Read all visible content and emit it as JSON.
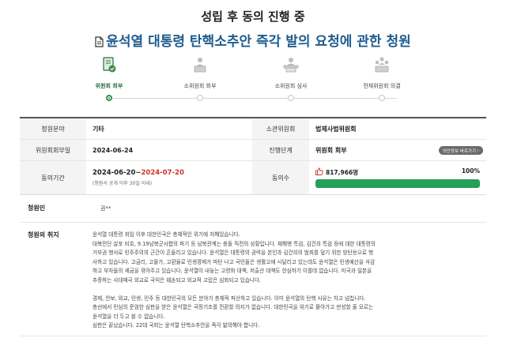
{
  "status_heading": "성립 후 동의 진행 중",
  "title": "윤석열 대통령 탄핵소추안 즉각 발의 요청에 관한 청원",
  "steps": [
    {
      "label": "위원회 회부",
      "active": true,
      "icon": "document-check-icon"
    },
    {
      "label": "소위원회 회부",
      "active": false,
      "icon": "podium-icon"
    },
    {
      "label": "소위원회 심사",
      "active": false,
      "icon": "reviewer-icon"
    },
    {
      "label": "전체위원회 의결",
      "active": false,
      "icon": "committee-icon"
    }
  ],
  "info": {
    "field_label": "청원분야",
    "field_value": "기타",
    "committee_label": "소관위원회",
    "committee_value": "법제사법위원회",
    "referral_date_label": "위원회회부일",
    "referral_date_value": "2024-06-24",
    "stage_label": "진행단계",
    "stage_value": "위원회 회부",
    "stage_button": "의안정보 바로가기",
    "period_label": "동의기간",
    "period_start": "2024-06-20~",
    "period_end": "2024-07-20",
    "period_note": "(청원서 공개 이후 30일 이내)",
    "votes_label": "동의수",
    "votes_count": "817,966명",
    "votes_percent": "100%",
    "votes_fill": 1.0
  },
  "petitioner": {
    "label": "청원인",
    "value": "권**"
  },
  "purpose": {
    "label": "청원의 취지",
    "paragraphs": [
      "윤석열 대통령 취임 이후 대한민국은 총체적인 위기에 처해있습니다.",
      "대북전단 살포 비호, 9.19남북군사합의 파기 등 남북관계는 충돌 직전의 상황입니다. 채해병 특검, 김건희 특검 등에 대한 대통령의",
      "거부권 행사로 민주주의의 근간이 흔들리고 있습니다. 윤석열은 대통령의 권력을 본인과 김건희의 범죄를 덮기 위한 방탄용으로 행",
      "사하고 있습니다. 고금리, 고물가, 고환율로 민생경제가 파탄 나고 국민들은 생활고에 시달리고 있는데도 윤석열은 민생예산을 삭감",
      "하고 부자들의 세금을 깎아주고 있습니다. 윤석열이 내놓는 고령화 대책, 저출산 대책도 한심하기 이를데 없습니다. 미국과 일본을",
      "추종하는 사대매국 외교로 국익은 훼손되고 외교적 고립은 심화되고 있습니다.",
      "",
      "경제, 안보, 외교, 민생, 민주 등 대한민국의 모든 분야가 총체적 파산하고 있습니다. 이미 윤석열의 탄핵 사유는 차고 넘칩니다.",
      "총선에서 민심의 준엄한 심판을 받은 윤석열은 국정기조를 전환할 의지가 없습니다. 대한민국을 위기로 몰아가고 반성할 줄 모르는",
      "윤석열을 더 두고 볼 수 없습니다.",
      "심판은 끝났습니다. 22대 국회는 윤석열 탄핵소추안을 즉각 발의해야 합니다."
    ]
  },
  "colors": {
    "title_blue": "#1f5c8f",
    "active_green": "#2e6d3e",
    "progress_green": "#24a05a",
    "date_red": "#d0342c"
  }
}
